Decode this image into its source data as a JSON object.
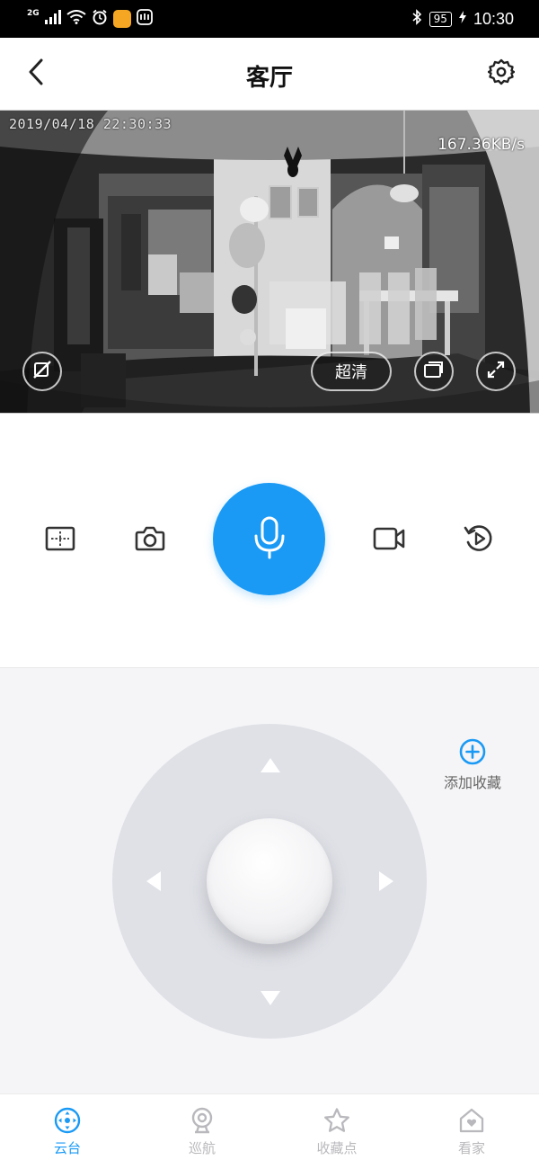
{
  "status_bar": {
    "network_type": "2G",
    "battery": "95",
    "time": "10:30"
  },
  "header": {
    "title": "客厅"
  },
  "video": {
    "timestamp": "2019/04/18  22:30:33",
    "bitrate": "167.36KB/s",
    "quality_label": "超清"
  },
  "controls": {
    "icons": [
      "split-screen-icon",
      "camera-icon",
      "microphone-icon",
      "video-record-icon",
      "playback-icon"
    ]
  },
  "ptz": {
    "add_favorite_label": "添加收藏"
  },
  "nav": {
    "items": [
      {
        "label": "云台",
        "icon": "ptz-control-icon",
        "active": true
      },
      {
        "label": "巡航",
        "icon": "cruise-camera-icon",
        "active": false
      },
      {
        "label": "收藏点",
        "icon": "star-icon",
        "active": false
      },
      {
        "label": "看家",
        "icon": "home-heart-icon",
        "active": false
      }
    ]
  },
  "colors": {
    "accent": "#1a9af5",
    "inactive": "#b9b9bd",
    "pad": "#dfe1e7",
    "background_panel": "#f5f5f7"
  }
}
